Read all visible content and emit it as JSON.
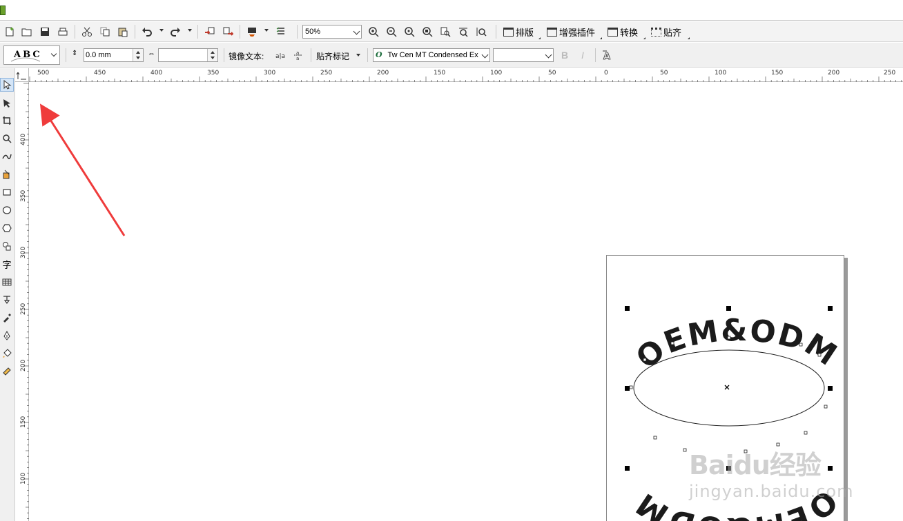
{
  "toolbar": {
    "zoom": {
      "value": "50%"
    },
    "menus": [
      {
        "label": "排版"
      },
      {
        "label": "增强插件"
      },
      {
        "label": "转换"
      },
      {
        "label": "贴齐"
      }
    ]
  },
  "property_bar": {
    "preset_preview": "ABC",
    "distance_value": "0.0 mm",
    "offset_value": "",
    "mirror_label": "镜像文本:",
    "snap_label": "贴齐标记",
    "font_name": "Tw Cen MT Condensed Ex",
    "font_size": ""
  },
  "rulers": {
    "top_labels": [
      "500",
      "450",
      "400",
      "350",
      "300",
      "250",
      "200",
      "150",
      "100",
      "50",
      "0",
      "50",
      "100",
      "150",
      "200",
      "250"
    ],
    "left_labels": [
      "400",
      "350",
      "300",
      "250",
      "200",
      "150",
      "100"
    ]
  },
  "canvas": {
    "artwork_text_top": "OEM&ODM",
    "artwork_text_bottom": "OEM&ODM",
    "annotation_color": "#ef3b3b"
  },
  "watermark": {
    "brand": "Baidu经验",
    "url": "jingyan.baidu.com"
  }
}
